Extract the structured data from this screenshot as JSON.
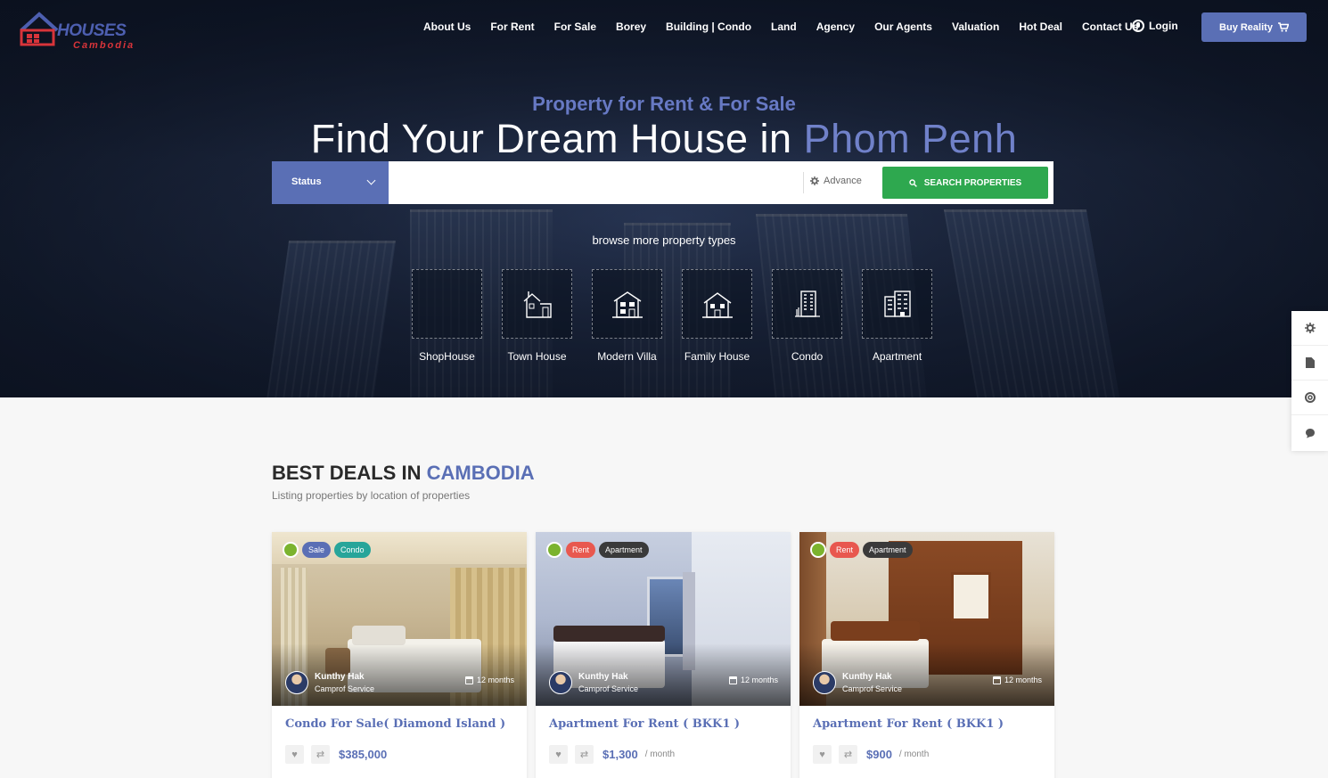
{
  "logo": {
    "line1": "HOUSES",
    "line2": "Cambodia"
  },
  "nav": {
    "items": [
      "About Us",
      "For Rent",
      "For Sale",
      "Borey",
      "Building | Condo",
      "Land",
      "Agency",
      "Our Agents",
      "Valuation",
      "Hot Deal",
      "Contact Us"
    ],
    "login": "Login",
    "buy": "Buy Reality"
  },
  "hero": {
    "subtitle": "Property for Rent & For Sale",
    "headline": "Find Your Dream House in",
    "headline_accent": "Phom Penh",
    "browse": "browse more property types"
  },
  "search": {
    "status": "Status",
    "value": "",
    "advance": "Advance",
    "button": "SEARCH PROPERTIES"
  },
  "types": [
    "ShopHouse",
    "Town House",
    "Modern Villa",
    "Family House",
    "Condo",
    "Apartment"
  ],
  "section": {
    "title": "BEST DEALS IN",
    "title_accent": "CAMBODIA",
    "subtitle": "Listing properties by location of properties"
  },
  "cards": [
    {
      "badges": [
        "Sale",
        "Condo"
      ],
      "agent": "Kunthy Hak",
      "company": "Camprof Service",
      "duration": "12 months",
      "title": "Condo For Sale( Diamond Island )",
      "price": "$385,000",
      "per": ""
    },
    {
      "badges": [
        "Rent",
        "Apartment"
      ],
      "agent": "Kunthy Hak",
      "company": "Camprof Service",
      "duration": "12 months",
      "title": "Apartment For Rent ( BKK1 )",
      "price": "$1,300",
      "per": "/ month"
    },
    {
      "badges": [
        "Rent",
        "Apartment"
      ],
      "agent": "Kunthy Hak",
      "company": "Camprof Service",
      "duration": "12 months",
      "title": "Apartment For Rent ( BKK1 )",
      "price": "$900",
      "per": "/ month"
    }
  ],
  "colors": {
    "accent": "#5a6fb5",
    "search_button": "#2ea84f",
    "sale": "#5a6fb5",
    "condo": "#27a59a",
    "rent": "#e8584f",
    "apartment": "#3a3a3a"
  }
}
